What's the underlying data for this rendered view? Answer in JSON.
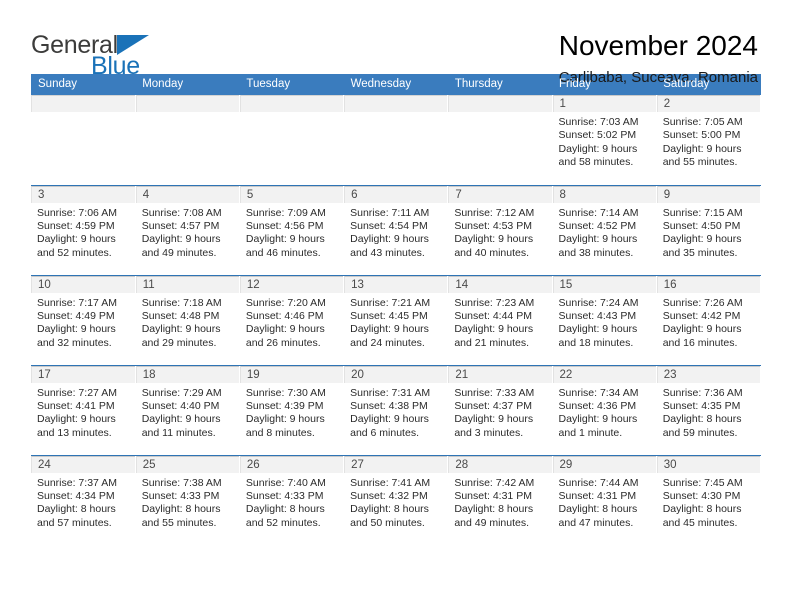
{
  "brand": {
    "name_part1": "General",
    "name_part2": "Blue",
    "flag_icon": "flag-triangle-icon"
  },
  "header": {
    "title": "November 2024",
    "subtitle": "Carlibaba, Suceava, Romania"
  },
  "colors": {
    "header_blue": "#3a7cbe",
    "row_separator_blue": "#2e74b5",
    "daynum_band": "#f2f2f2",
    "brand_blue": "#1a72b8"
  },
  "weekday_headers": [
    "Sunday",
    "Monday",
    "Tuesday",
    "Wednesday",
    "Thursday",
    "Friday",
    "Saturday"
  ],
  "weeks": [
    [
      {
        "empty": true
      },
      {
        "empty": true
      },
      {
        "empty": true
      },
      {
        "empty": true
      },
      {
        "empty": true
      },
      {
        "day": "1",
        "sunrise": "Sunrise: 7:03 AM",
        "sunset": "Sunset: 5:02 PM",
        "daylight": "Daylight: 9 hours and 58 minutes."
      },
      {
        "day": "2",
        "sunrise": "Sunrise: 7:05 AM",
        "sunset": "Sunset: 5:00 PM",
        "daylight": "Daylight: 9 hours and 55 minutes."
      }
    ],
    [
      {
        "day": "3",
        "sunrise": "Sunrise: 7:06 AM",
        "sunset": "Sunset: 4:59 PM",
        "daylight": "Daylight: 9 hours and 52 minutes."
      },
      {
        "day": "4",
        "sunrise": "Sunrise: 7:08 AM",
        "sunset": "Sunset: 4:57 PM",
        "daylight": "Daylight: 9 hours and 49 minutes."
      },
      {
        "day": "5",
        "sunrise": "Sunrise: 7:09 AM",
        "sunset": "Sunset: 4:56 PM",
        "daylight": "Daylight: 9 hours and 46 minutes."
      },
      {
        "day": "6",
        "sunrise": "Sunrise: 7:11 AM",
        "sunset": "Sunset: 4:54 PM",
        "daylight": "Daylight: 9 hours and 43 minutes."
      },
      {
        "day": "7",
        "sunrise": "Sunrise: 7:12 AM",
        "sunset": "Sunset: 4:53 PM",
        "daylight": "Daylight: 9 hours and 40 minutes."
      },
      {
        "day": "8",
        "sunrise": "Sunrise: 7:14 AM",
        "sunset": "Sunset: 4:52 PM",
        "daylight": "Daylight: 9 hours and 38 minutes."
      },
      {
        "day": "9",
        "sunrise": "Sunrise: 7:15 AM",
        "sunset": "Sunset: 4:50 PM",
        "daylight": "Daylight: 9 hours and 35 minutes."
      }
    ],
    [
      {
        "day": "10",
        "sunrise": "Sunrise: 7:17 AM",
        "sunset": "Sunset: 4:49 PM",
        "daylight": "Daylight: 9 hours and 32 minutes."
      },
      {
        "day": "11",
        "sunrise": "Sunrise: 7:18 AM",
        "sunset": "Sunset: 4:48 PM",
        "daylight": "Daylight: 9 hours and 29 minutes."
      },
      {
        "day": "12",
        "sunrise": "Sunrise: 7:20 AM",
        "sunset": "Sunset: 4:46 PM",
        "daylight": "Daylight: 9 hours and 26 minutes."
      },
      {
        "day": "13",
        "sunrise": "Sunrise: 7:21 AM",
        "sunset": "Sunset: 4:45 PM",
        "daylight": "Daylight: 9 hours and 24 minutes."
      },
      {
        "day": "14",
        "sunrise": "Sunrise: 7:23 AM",
        "sunset": "Sunset: 4:44 PM",
        "daylight": "Daylight: 9 hours and 21 minutes."
      },
      {
        "day": "15",
        "sunrise": "Sunrise: 7:24 AM",
        "sunset": "Sunset: 4:43 PM",
        "daylight": "Daylight: 9 hours and 18 minutes."
      },
      {
        "day": "16",
        "sunrise": "Sunrise: 7:26 AM",
        "sunset": "Sunset: 4:42 PM",
        "daylight": "Daylight: 9 hours and 16 minutes."
      }
    ],
    [
      {
        "day": "17",
        "sunrise": "Sunrise: 7:27 AM",
        "sunset": "Sunset: 4:41 PM",
        "daylight": "Daylight: 9 hours and 13 minutes."
      },
      {
        "day": "18",
        "sunrise": "Sunrise: 7:29 AM",
        "sunset": "Sunset: 4:40 PM",
        "daylight": "Daylight: 9 hours and 11 minutes."
      },
      {
        "day": "19",
        "sunrise": "Sunrise: 7:30 AM",
        "sunset": "Sunset: 4:39 PM",
        "daylight": "Daylight: 9 hours and 8 minutes."
      },
      {
        "day": "20",
        "sunrise": "Sunrise: 7:31 AM",
        "sunset": "Sunset: 4:38 PM",
        "daylight": "Daylight: 9 hours and 6 minutes."
      },
      {
        "day": "21",
        "sunrise": "Sunrise: 7:33 AM",
        "sunset": "Sunset: 4:37 PM",
        "daylight": "Daylight: 9 hours and 3 minutes."
      },
      {
        "day": "22",
        "sunrise": "Sunrise: 7:34 AM",
        "sunset": "Sunset: 4:36 PM",
        "daylight": "Daylight: 9 hours and 1 minute."
      },
      {
        "day": "23",
        "sunrise": "Sunrise: 7:36 AM",
        "sunset": "Sunset: 4:35 PM",
        "daylight": "Daylight: 8 hours and 59 minutes."
      }
    ],
    [
      {
        "day": "24",
        "sunrise": "Sunrise: 7:37 AM",
        "sunset": "Sunset: 4:34 PM",
        "daylight": "Daylight: 8 hours and 57 minutes."
      },
      {
        "day": "25",
        "sunrise": "Sunrise: 7:38 AM",
        "sunset": "Sunset: 4:33 PM",
        "daylight": "Daylight: 8 hours and 55 minutes."
      },
      {
        "day": "26",
        "sunrise": "Sunrise: 7:40 AM",
        "sunset": "Sunset: 4:33 PM",
        "daylight": "Daylight: 8 hours and 52 minutes."
      },
      {
        "day": "27",
        "sunrise": "Sunrise: 7:41 AM",
        "sunset": "Sunset: 4:32 PM",
        "daylight": "Daylight: 8 hours and 50 minutes."
      },
      {
        "day": "28",
        "sunrise": "Sunrise: 7:42 AM",
        "sunset": "Sunset: 4:31 PM",
        "daylight": "Daylight: 8 hours and 49 minutes."
      },
      {
        "day": "29",
        "sunrise": "Sunrise: 7:44 AM",
        "sunset": "Sunset: 4:31 PM",
        "daylight": "Daylight: 8 hours and 47 minutes."
      },
      {
        "day": "30",
        "sunrise": "Sunrise: 7:45 AM",
        "sunset": "Sunset: 4:30 PM",
        "daylight": "Daylight: 8 hours and 45 minutes."
      }
    ]
  ]
}
